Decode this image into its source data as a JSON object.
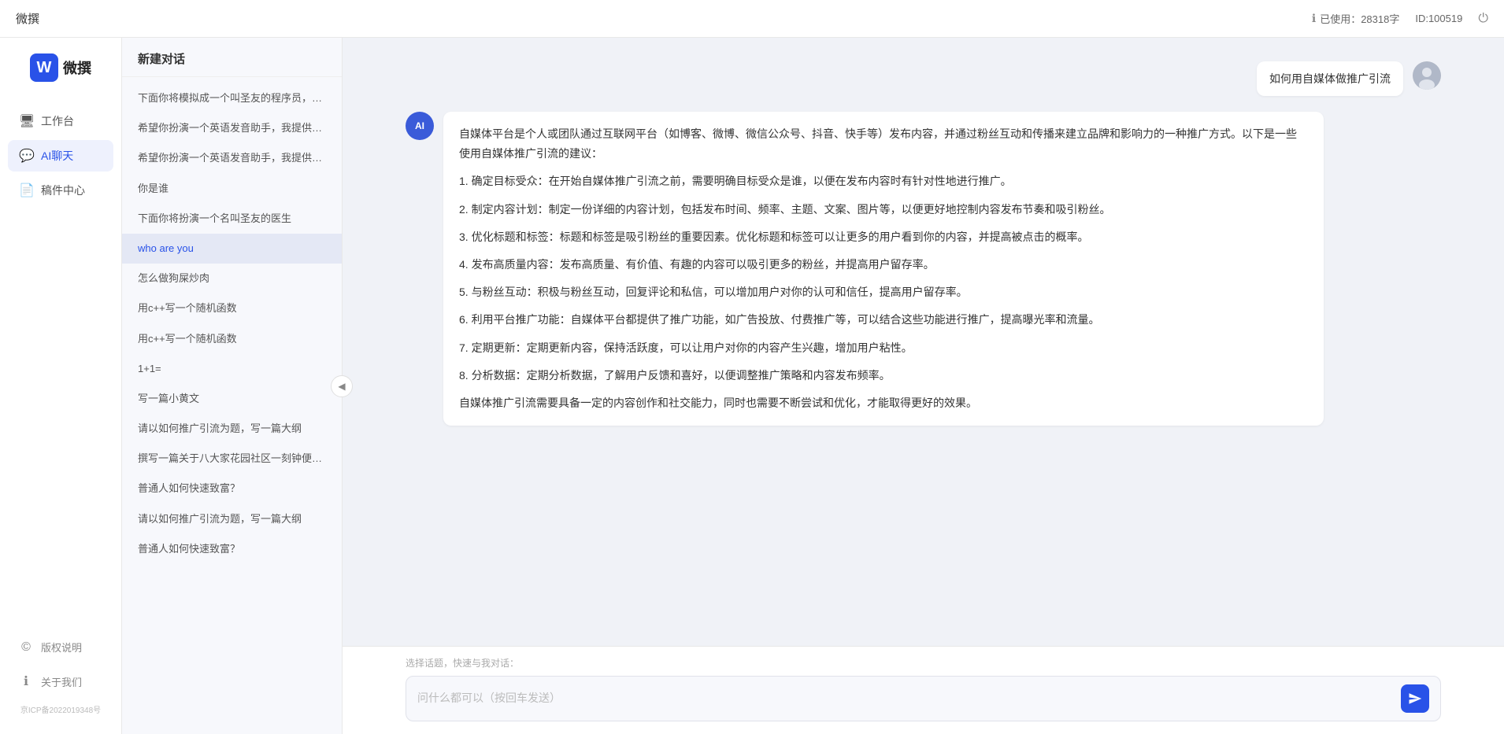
{
  "topbar": {
    "title": "微撰",
    "usage_label": "已使用：28318字",
    "id_label": "ID:100519",
    "info_icon": "info-icon",
    "logout_icon": "power-icon"
  },
  "logo": {
    "letter": "W",
    "text": "微撰"
  },
  "nav": {
    "items": [
      {
        "id": "workbench",
        "icon": "🖥",
        "label": "工作台"
      },
      {
        "id": "ai-chat",
        "icon": "💬",
        "label": "AI聊天"
      },
      {
        "id": "drafts",
        "icon": "📄",
        "label": "稿件中心"
      }
    ],
    "active": "ai-chat"
  },
  "sidebar_bottom": {
    "items": [
      {
        "id": "copyright",
        "icon": "©",
        "label": "版权说明"
      },
      {
        "id": "about",
        "icon": "ℹ",
        "label": "关于我们"
      }
    ],
    "icp": "京ICP备2022019348号"
  },
  "conv_panel": {
    "new_chat_label": "新建对话",
    "conversations": [
      {
        "id": 1,
        "text": "下面你将模拟成一个叫圣友的程序员，我说...",
        "active": false
      },
      {
        "id": 2,
        "text": "希望你扮演一个英语发音助手，我提供给你...",
        "active": false
      },
      {
        "id": 3,
        "text": "希望你扮演一个英语发音助手，我提供给你...",
        "active": false
      },
      {
        "id": 4,
        "text": "你是谁",
        "active": false
      },
      {
        "id": 5,
        "text": "下面你将扮演一个名叫圣友的医生",
        "active": false
      },
      {
        "id": 6,
        "text": "who are you",
        "active": true
      },
      {
        "id": 7,
        "text": "怎么做狗屎炒肉",
        "active": false
      },
      {
        "id": 8,
        "text": "用c++写一个随机函数",
        "active": false
      },
      {
        "id": 9,
        "text": "用c++写一个随机函数",
        "active": false
      },
      {
        "id": 10,
        "text": "1+1=",
        "active": false
      },
      {
        "id": 11,
        "text": "写一篇小黄文",
        "active": false
      },
      {
        "id": 12,
        "text": "请以如何推广引流为题，写一篇大纲",
        "active": false
      },
      {
        "id": 13,
        "text": "撰写一篇关于八大家花园社区一刻钟便民生...",
        "active": false
      },
      {
        "id": 14,
        "text": "普通人如何快速致富？",
        "active": false
      },
      {
        "id": 15,
        "text": "请以如何推广引流为题，写一篇大纲",
        "active": false
      },
      {
        "id": 16,
        "text": "普通人如何快速致富？",
        "active": false
      }
    ]
  },
  "chat": {
    "user_message": "如何用自媒体做推广引流",
    "ai_response": {
      "paragraphs": [
        "自媒体平台是个人或团队通过互联网平台（如博客、微博、微信公众号、抖音、快手等）发布内容，并通过粉丝互动和传播来建立品牌和影响力的一种推广方式。以下是一些使用自媒体推广引流的建议：",
        "1. 确定目标受众：在开始自媒体推广引流之前，需要明确目标受众是谁，以便在发布内容时有针对性地进行推广。",
        "2. 制定内容计划：制定一份详细的内容计划，包括发布时间、频率、主题、文案、图片等，以便更好地控制内容发布节奏和吸引粉丝。",
        "3. 优化标题和标签：标题和标签是吸引粉丝的重要因素。优化标题和标签可以让更多的用户看到你的内容，并提高被点击的概率。",
        "4. 发布高质量内容：发布高质量、有价值、有趣的内容可以吸引更多的粉丝，并提高用户留存率。",
        "5. 与粉丝互动：积极与粉丝互动，回复评论和私信，可以增加用户对你的认可和信任，提高用户留存率。",
        "6. 利用平台推广功能：自媒体平台都提供了推广功能，如广告投放、付费推广等，可以结合这些功能进行推广，提高曝光率和流量。",
        "7. 定期更新：定期更新内容，保持活跃度，可以让用户对你的内容产生兴趣，增加用户粘性。",
        "8. 分析数据：定期分析数据，了解用户反馈和喜好，以便调整推广策略和内容发布频率。",
        "自媒体推广引流需要具备一定的内容创作和社交能力，同时也需要不断尝试和优化，才能取得更好的效果。"
      ]
    },
    "quick_topics_placeholder": "选择话题，快速与我对话：",
    "input_placeholder": "问什么都可以（按回车发送）"
  }
}
